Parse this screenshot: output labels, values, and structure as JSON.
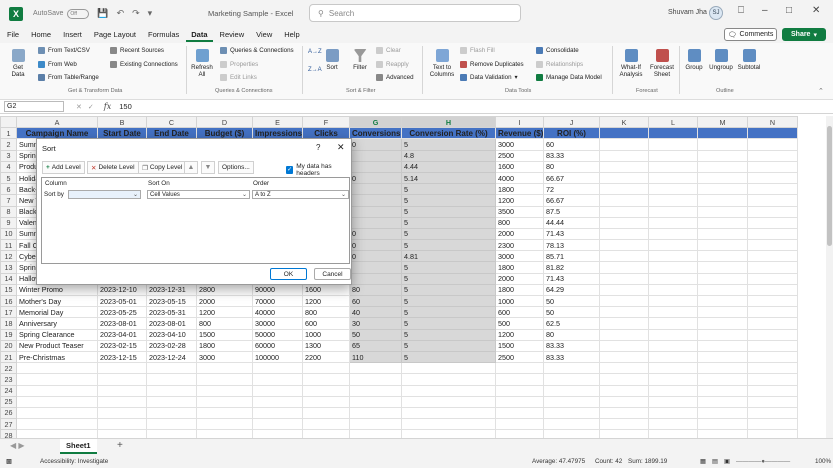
{
  "titlebar": {
    "autosave_label": "AutoSave",
    "autosave_state": "Off",
    "doc_title": "Marketing Sample  -  Excel",
    "search_placeholder": "Search",
    "user_name": "Shuvam Jha",
    "user_initials": "SJ"
  },
  "menu": [
    "File",
    "Home",
    "Insert",
    "Page Layout",
    "Formulas",
    "Data",
    "Review",
    "View",
    "Help"
  ],
  "active_menu": "Data",
  "comments_label": "Comments",
  "share_label": "Share",
  "ribbon": {
    "get_data": "Get Data",
    "from_text_csv": "From Text/CSV",
    "from_web": "From Web",
    "from_table_range": "From Table/Range",
    "recent_sources": "Recent Sources",
    "existing_connections": "Existing Connections",
    "group_get_transform": "Get & Transform Data",
    "refresh_all": "Refresh All",
    "queries_connections": "Queries & Connections",
    "properties": "Properties",
    "edit_links": "Edit Links",
    "group_queries": "Queries & Connections",
    "sort_az": "A→Z",
    "sort_za": "Z→A",
    "sort": "Sort",
    "filter": "Filter",
    "clear": "Clear",
    "reapply": "Reapply",
    "advanced": "Advanced",
    "group_sort_filter": "Sort & Filter",
    "text_to_columns": "Text to Columns",
    "flash_fill": "Flash Fill",
    "remove_duplicates": "Remove Duplicates",
    "data_validation": "Data Validation",
    "consolidate": "Consolidate",
    "relationships": "Relationships",
    "manage_data_model": "Manage Data Model",
    "group_data_tools": "Data Tools",
    "what_if": "What-If Analysis",
    "forecast_sheet": "Forecast Sheet",
    "group_forecast": "Forecast",
    "group": "Group",
    "ungroup": "Ungroup",
    "subtotal": "Subtotal",
    "group_outline": "Outline"
  },
  "formula_bar": {
    "name_box": "G2",
    "formula": "150"
  },
  "columns": [
    "A",
    "B",
    "C",
    "D",
    "E",
    "F",
    "G",
    "H",
    "I",
    "J",
    "K",
    "L",
    "M",
    "N"
  ],
  "header_row": [
    "Campaign Name",
    "Start Date",
    "End Date",
    "Budget ($)",
    "Impressions",
    "Clicks",
    "Conversions",
    "Conversion Rate (%)",
    "Revenue ($)",
    "ROI (%)"
  ],
  "rows": [
    [
      "Summ",
      "",
      "",
      "",
      "",
      "",
      "0",
      "5",
      "3000",
      "60"
    ],
    [
      "Spring",
      "",
      "",
      "",
      "",
      "",
      "",
      "4.8",
      "2500",
      "83.33"
    ],
    [
      "Produ",
      "",
      "",
      "",
      "",
      "",
      "",
      "4.44",
      "1600",
      "80"
    ],
    [
      "Holida",
      "",
      "",
      "",
      "",
      "",
      "0",
      "5.14",
      "4000",
      "66.67"
    ],
    [
      "Back-t",
      "",
      "",
      "",
      "",
      "",
      "",
      "5",
      "1800",
      "72"
    ],
    [
      "New Y",
      "",
      "",
      "",
      "",
      "",
      "",
      "5",
      "1200",
      "66.67"
    ],
    [
      "Black",
      "",
      "",
      "",
      "",
      "",
      "",
      "5",
      "3500",
      "87.5"
    ],
    [
      "Valent",
      "",
      "",
      "",
      "",
      "",
      "",
      "5",
      "800",
      "44.44"
    ],
    [
      "Summ",
      "",
      "",
      "",
      "",
      "",
      "0",
      "5",
      "2000",
      "71.43"
    ],
    [
      "Fall C",
      "",
      "",
      "",
      "",
      "",
      "0",
      "5",
      "2300",
      "78.13"
    ],
    [
      "Cyber",
      "",
      "",
      "",
      "",
      "",
      "0",
      "4.81",
      "3000",
      "85.71"
    ],
    [
      "Spring",
      "",
      "",
      "",
      "",
      "",
      "",
      "5",
      "1800",
      "81.82"
    ],
    [
      "Hallow",
      "",
      "",
      "",
      "",
      "",
      "",
      "5",
      "2000",
      "71.43"
    ],
    [
      "Winter Promo",
      "2023-12-10",
      "2023-12-31",
      "2800",
      "90000",
      "1600",
      "80",
      "5",
      "1800",
      "64.29"
    ],
    [
      "Mother's Day",
      "2023-05-01",
      "2023-05-15",
      "2000",
      "70000",
      "1200",
      "60",
      "5",
      "1000",
      "50"
    ],
    [
      "Memorial Day",
      "2023-05-25",
      "2023-05-31",
      "1200",
      "40000",
      "800",
      "40",
      "5",
      "600",
      "50"
    ],
    [
      "Anniversary",
      "2023-08-01",
      "2023-08-01",
      "800",
      "30000",
      "600",
      "30",
      "5",
      "500",
      "62.5"
    ],
    [
      "Spring Clearance",
      "2023-04-01",
      "2023-04-10",
      "1500",
      "50000",
      "1000",
      "50",
      "5",
      "1200",
      "80"
    ],
    [
      "New Product Teaser",
      "2023-02-15",
      "2023-02-28",
      "1800",
      "60000",
      "1300",
      "65",
      "5",
      "1500",
      "83.33"
    ],
    [
      "Pre-Christmas",
      "2023-12-15",
      "2023-12-24",
      "3000",
      "100000",
      "2200",
      "110",
      "5",
      "2500",
      "83.33"
    ]
  ],
  "sheet_tab": "Sheet1",
  "status": {
    "accessibility": "Accessibility: Investigate",
    "average": "Average: 47.47975",
    "count": "Count: 42",
    "sum": "Sum: 1899.19",
    "zoom": "100%"
  },
  "sort_dialog": {
    "title": "Sort",
    "help": "?",
    "add_level": "Add Level",
    "delete_level": "Delete Level",
    "copy_level": "Copy Level",
    "options": "Options...",
    "my_data_has_headers": "My data has headers",
    "col_header": "Column",
    "sort_on_header": "Sort On",
    "order_header": "Order",
    "sort_by_label": "Sort by",
    "sort_by_value": "",
    "sort_on_value": "Cell Values",
    "order_value": "A to Z",
    "ok": "OK",
    "cancel": "Cancel"
  },
  "colors": {
    "accent": "#107c41",
    "header_fill": "#4472c4",
    "selection_fill": "#d8d8d8"
  }
}
